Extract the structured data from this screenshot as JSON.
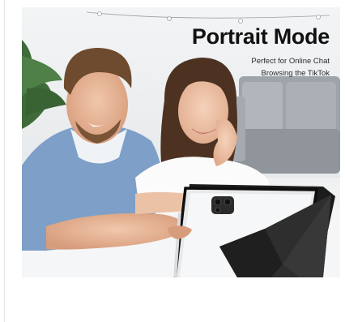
{
  "banner": {
    "title": "Portrait Mode",
    "subtitle_lines": [
      "Perfect for Online Chat",
      "Browsing the TikTok"
    ],
    "image_alt": "Couple smiling at a tablet in a black folding case standing in portrait mode"
  }
}
